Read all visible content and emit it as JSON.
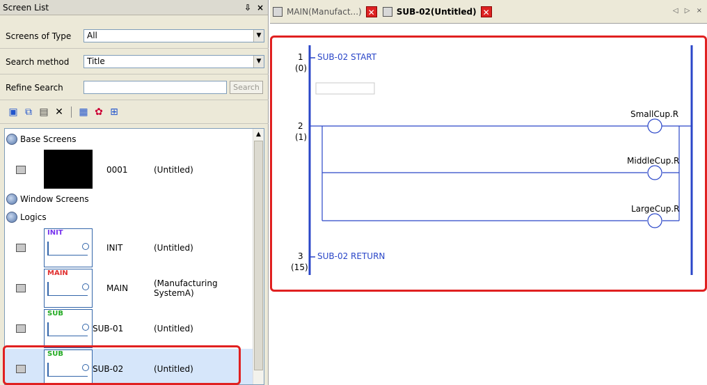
{
  "left_panel": {
    "title": "Screen List",
    "pin": "↕",
    "close": "×",
    "screens_of_type_label": "Screens of Type",
    "screens_of_type_value": "All",
    "search_method_label": "Search method",
    "search_method_value": "Title",
    "refine_search_label": "Refine Search",
    "refine_search_value": "",
    "search_button": "Search",
    "groups": {
      "base": "Base Screens",
      "window": "Window Screens",
      "logics": "Logics"
    },
    "items": [
      {
        "name": "0001",
        "title": "(Untitled)",
        "thumb": "black",
        "tag": ""
      },
      {
        "name": "INIT",
        "title": "(Untitled)",
        "thumb": "ladder",
        "tag": "INIT"
      },
      {
        "name": "MAIN",
        "title": "(Manufacturing SystemA)",
        "thumb": "ladder",
        "tag": "MAIN"
      },
      {
        "name": "SUB-01",
        "title": "(Untitled)",
        "thumb": "ladder",
        "tag": "SUB"
      },
      {
        "name": "SUB-02",
        "title": "(Untitled)",
        "thumb": "ladder",
        "tag": "SUB"
      }
    ]
  },
  "tabs": [
    {
      "label": "MAIN(Manufact...)",
      "active": false
    },
    {
      "label": "SUB-02(Untitled)",
      "active": true
    }
  ],
  "tab_nav": "◁ ▷ ×",
  "ladder": {
    "rung1_num": "1",
    "rung1_step": "(0)",
    "rung1_label": "SUB-02 START",
    "rung2_num": "2",
    "rung2_step": "(1)",
    "coil1": "SmallCup.R",
    "coil2": "MiddleCup.R",
    "coil3": "LargeCup.R",
    "rung3_num": "3",
    "rung3_step": "(15)",
    "rung3_label": "SUB-02 RETURN"
  },
  "colors": {
    "highlight": "#e02020",
    "ladder_blue": "#2a46c8",
    "selection": "#d6e6fa"
  }
}
